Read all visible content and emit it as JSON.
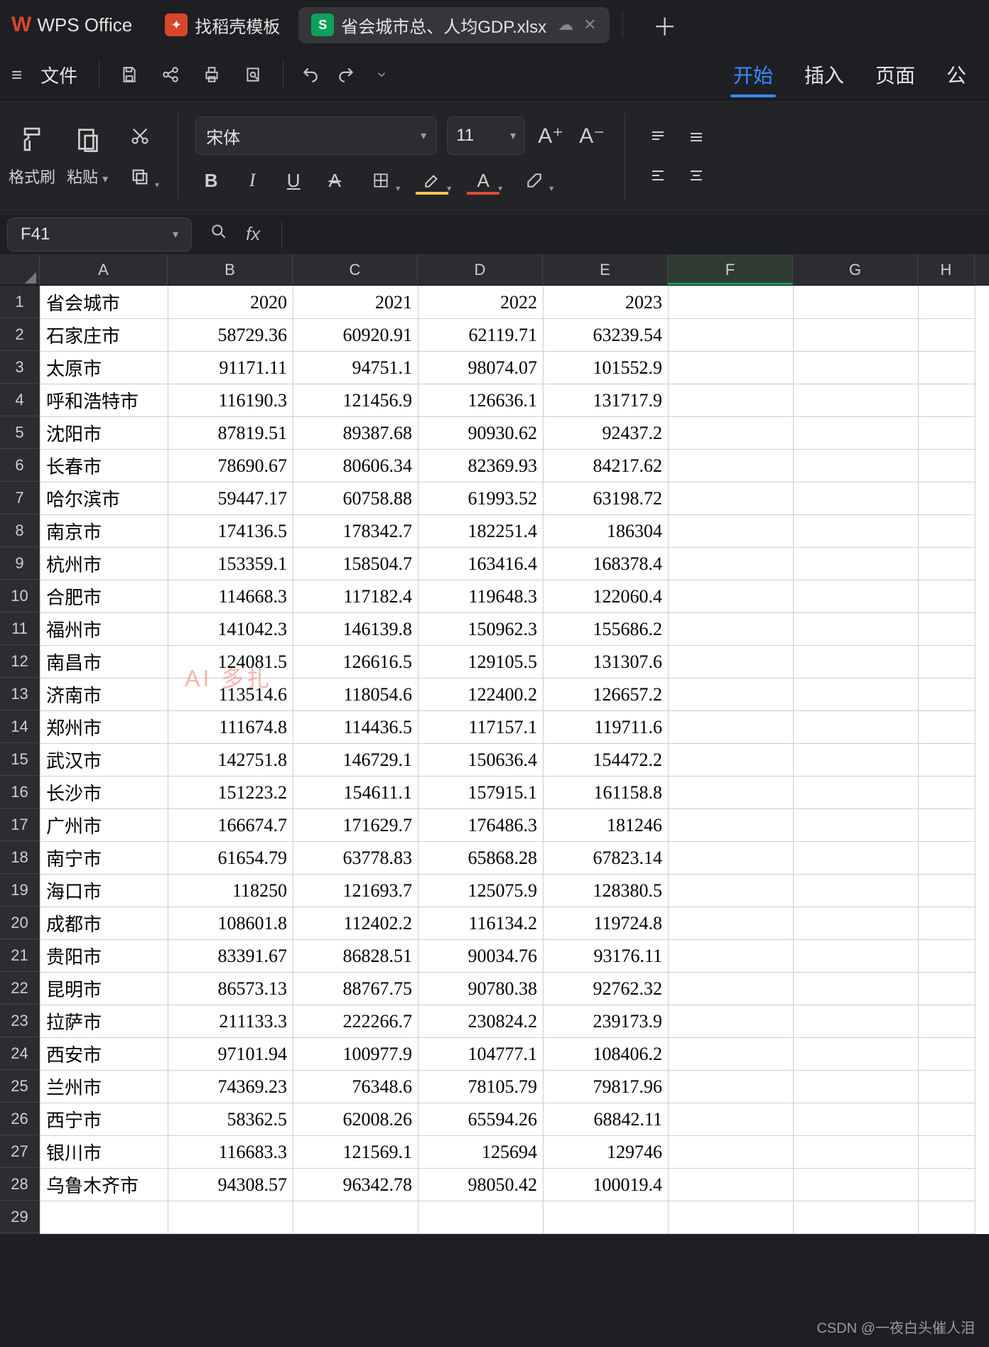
{
  "titlebar": {
    "app_name": "WPS Office",
    "doke_tab": "找稻壳模板",
    "file_tab": "省会城市总、人均GDP.xlsx",
    "plus": "＋"
  },
  "menu": {
    "file_label": "文件",
    "ribbon_tabs": {
      "start": "开始",
      "insert": "插入",
      "page": "页面",
      "more": "公"
    }
  },
  "ribbon": {
    "format_painter": "格式刷",
    "paste": "粘贴",
    "font_name": "宋体",
    "font_size": "11",
    "bold": "B",
    "italic": "I",
    "underline": "U",
    "strike": "A",
    "increase_font": "A⁺",
    "decrease_font": "A⁻"
  },
  "fxrow": {
    "cell_ref": "F41",
    "fx": "fx"
  },
  "columns": [
    "A",
    "B",
    "C",
    "D",
    "E",
    "F",
    "G",
    "H"
  ],
  "active_col": "F",
  "table": {
    "header_row": [
      "省会城市",
      "2020",
      "2021",
      "2022",
      "2023"
    ],
    "rows": [
      [
        "石家庄市",
        "58729.36",
        "60920.91",
        "62119.71",
        "63239.54"
      ],
      [
        "太原市",
        "91171.11",
        "94751.1",
        "98074.07",
        "101552.9"
      ],
      [
        "呼和浩特市",
        "116190.3",
        "121456.9",
        "126636.1",
        "131717.9"
      ],
      [
        "沈阳市",
        "87819.51",
        "89387.68",
        "90930.62",
        "92437.2"
      ],
      [
        "长春市",
        "78690.67",
        "80606.34",
        "82369.93",
        "84217.62"
      ],
      [
        "哈尔滨市",
        "59447.17",
        "60758.88",
        "61993.52",
        "63198.72"
      ],
      [
        "南京市",
        "174136.5",
        "178342.7",
        "182251.4",
        "186304"
      ],
      [
        "杭州市",
        "153359.1",
        "158504.7",
        "163416.4",
        "168378.4"
      ],
      [
        "合肥市",
        "114668.3",
        "117182.4",
        "119648.3",
        "122060.4"
      ],
      [
        "福州市",
        "141042.3",
        "146139.8",
        "150962.3",
        "155686.2"
      ],
      [
        "南昌市",
        "124081.5",
        "126616.5",
        "129105.5",
        "131307.6"
      ],
      [
        "济南市",
        "113514.6",
        "118054.6",
        "122400.2",
        "126657.2"
      ],
      [
        "郑州市",
        "111674.8",
        "114436.5",
        "117157.1",
        "119711.6"
      ],
      [
        "武汉市",
        "142751.8",
        "146729.1",
        "150636.4",
        "154472.2"
      ],
      [
        "长沙市",
        "151223.2",
        "154611.1",
        "157915.1",
        "161158.8"
      ],
      [
        "广州市",
        "166674.7",
        "171629.7",
        "176486.3",
        "181246"
      ],
      [
        "南宁市",
        "61654.79",
        "63778.83",
        "65868.28",
        "67823.14"
      ],
      [
        "海口市",
        "118250",
        "121693.7",
        "125075.9",
        "128380.5"
      ],
      [
        "成都市",
        "108601.8",
        "112402.2",
        "116134.2",
        "119724.8"
      ],
      [
        "贵阳市",
        "83391.67",
        "86828.51",
        "90034.76",
        "93176.11"
      ],
      [
        "昆明市",
        "86573.13",
        "88767.75",
        "90780.38",
        "92762.32"
      ],
      [
        "拉萨市",
        "211133.3",
        "222266.7",
        "230824.2",
        "239173.9"
      ],
      [
        "西安市",
        "97101.94",
        "100977.9",
        "104777.1",
        "108406.2"
      ],
      [
        "兰州市",
        "74369.23",
        "76348.6",
        "78105.79",
        "79817.96"
      ],
      [
        "西宁市",
        "58362.5",
        "62008.26",
        "65594.26",
        "68842.11"
      ],
      [
        "银川市",
        "116683.3",
        "121569.1",
        "125694",
        "129746"
      ],
      [
        "乌鲁木齐市",
        "94308.57",
        "96342.78",
        "98050.42",
        "100019.4"
      ]
    ],
    "visible_row_count": 29
  },
  "watermark": "CSDN @一夜白头催人泪"
}
